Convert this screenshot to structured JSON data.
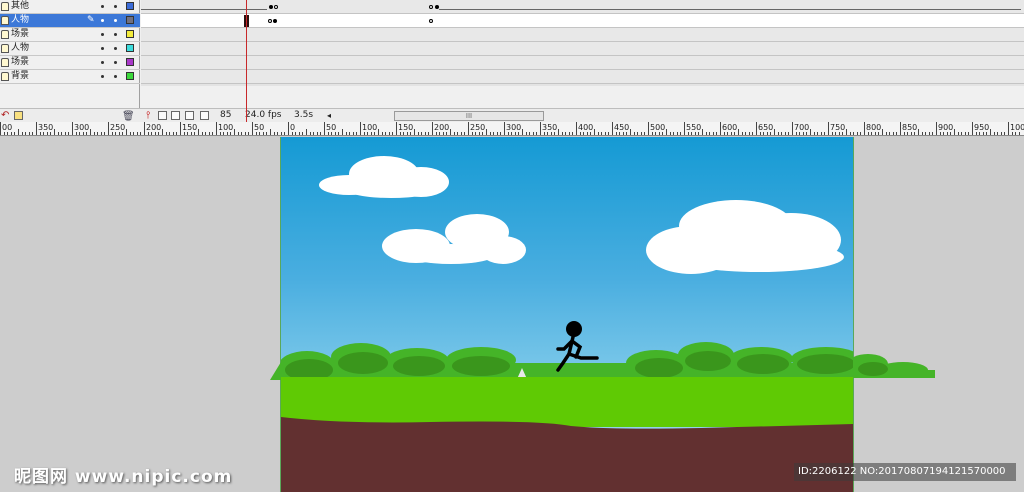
{
  "timeline": {
    "layers": [
      {
        "name": "其他",
        "color": "#3c6cd8",
        "selected": false
      },
      {
        "name": "人物",
        "color": "#707080",
        "selected": true
      },
      {
        "name": "场景",
        "color": "#f4ec3c",
        "selected": false
      },
      {
        "name": "人物",
        "color": "#3cdcdc",
        "selected": false
      },
      {
        "name": "场景",
        "color": "#a838c8",
        "selected": false
      },
      {
        "name": "背景",
        "color": "#3cd83c",
        "selected": false
      }
    ],
    "status": {
      "current_frame": "85",
      "frame_rate": "24.0 fps",
      "elapsed_time": "3.5s",
      "scrollbar_grip": "III"
    },
    "icons": [
      "add-layer-icon",
      "add-folder-icon",
      "delete-layer-icon",
      "center-frame-icon",
      "onion-skin-icon",
      "onion-outline-icon",
      "edit-multiple-frames-icon",
      "modify-onion-markers-icon"
    ]
  },
  "ruler": {
    "labels": [
      "00",
      "350",
      "300",
      "250",
      "200",
      "150",
      "100",
      "50",
      "0",
      "50",
      "100",
      "150",
      "200",
      "250",
      "300",
      "350",
      "400",
      "450",
      "500",
      "550",
      "600",
      "650",
      "700",
      "750",
      "800",
      "850",
      "900",
      "950",
      "1000"
    ]
  },
  "stage": {
    "sky_top_color": "#159ad4",
    "sky_bottom_color": "#a7dcef",
    "grass_color": "#5fca04",
    "bush_color": "#3f9a1e",
    "dirt_color": "#623030",
    "figure": "running-stick-figure"
  },
  "watermark": {
    "left": "昵图网 www.nipic.com",
    "right": "ID:2206122 NO:20170807194121570000"
  }
}
